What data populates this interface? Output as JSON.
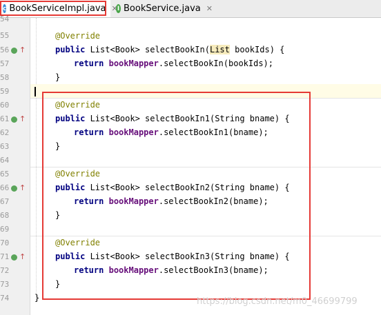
{
  "tabs": [
    {
      "label": "BookServiceImpl.java",
      "icon": "class-c-icon",
      "active": true
    },
    {
      "label": "BookService.java",
      "icon": "interface-i-icon",
      "active": false
    }
  ],
  "gutter": {
    "line_numbers": [
      "54",
      "55",
      "56",
      "57",
      "58",
      "59",
      "60",
      "61",
      "62",
      "63",
      "64",
      "65",
      "66",
      "67",
      "68",
      "69",
      "70",
      "71",
      "72",
      "73",
      "74"
    ]
  },
  "code": {
    "m0": {
      "ann": "@Override",
      "kw1": "public",
      "sig_a": " List<Book> selectBookIn(",
      "list_kw": "List",
      "sig_b": " bookIds) {",
      "ret": "return",
      "field": "bookMapper",
      "call": ".selectBookIn(bookIds);",
      "close": "}"
    },
    "m1": {
      "ann": "@Override",
      "kw1": "public",
      "sig": " List<Book> selectBookIn1(String bname) {",
      "ret": "return",
      "field": "bookMapper",
      "call": ".selectBookIn1(bname);",
      "close": "}"
    },
    "m2": {
      "ann": "@Override",
      "kw1": "public",
      "sig": " List<Book> selectBookIn2(String bname) {",
      "ret": "return",
      "field": "bookMapper",
      "call": ".selectBookIn2(bname);",
      "close": "}"
    },
    "m3": {
      "ann": "@Override",
      "kw1": "public",
      "sig": " List<Book> selectBookIn3(String bname) {",
      "ret": "return",
      "field": "bookMapper",
      "call": ".selectBookIn3(bname);",
      "close": "}"
    },
    "class_close": "}"
  },
  "watermark": "https://blog.csdn.net/m0_46699799",
  "colors": {
    "highlight_border": "#e53935",
    "annotation": "#808000",
    "keyword": "#000080",
    "field": "#660e7a",
    "gutter_icon": "#5aa55a"
  }
}
